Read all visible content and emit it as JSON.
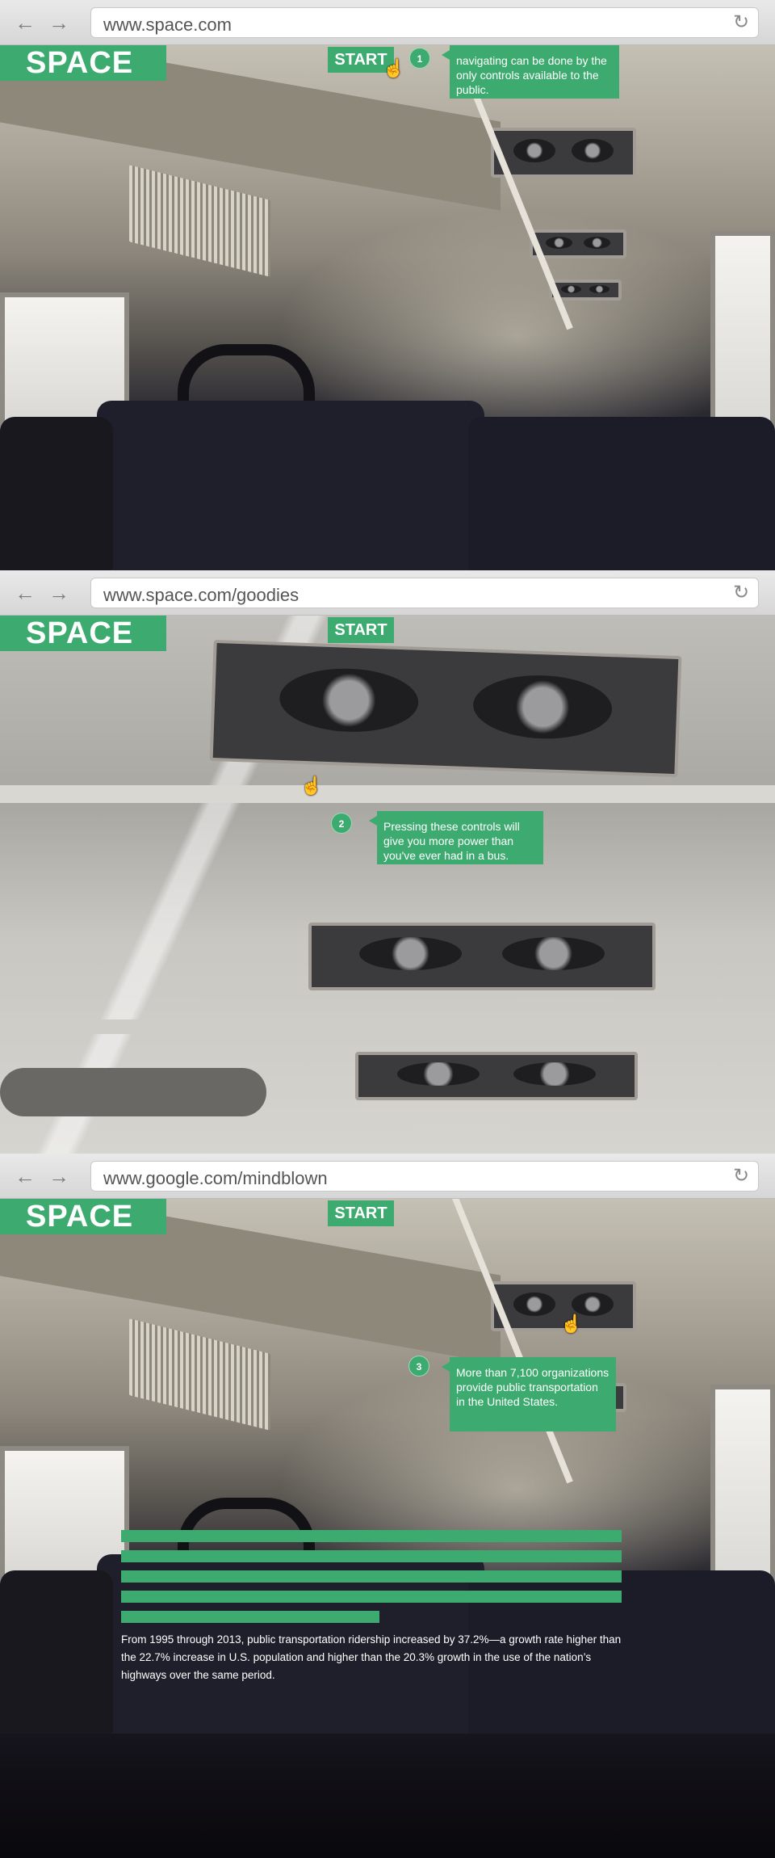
{
  "brand": {
    "logo": "SPACE",
    "start_label": "START",
    "accent_color": "#3dab70"
  },
  "browser": {
    "back_icon": "arrow-left-icon",
    "forward_icon": "arrow-right-icon",
    "reload_icon": "reload-icon"
  },
  "panels": [
    {
      "url": "www.space.com",
      "step": "1",
      "callout": "navigating can be done by the only controls available to the public."
    },
    {
      "url": "www.space.com/goodies",
      "step": "2",
      "callout": "Pressing these controls will give you more power than you've ever had in a bus."
    },
    {
      "url": "www.google.com/mindblown",
      "step": "3",
      "callout": "More than 7,100 organizations provide public transportation in the United States.",
      "article": "From 1995 through 2013, public transportation ridership increased by 37.2%—a growth rate higher than the 22.7% increase in U.S. population and higher than the 20.3% growth in the use of the nation’s highways over the same period."
    }
  ]
}
